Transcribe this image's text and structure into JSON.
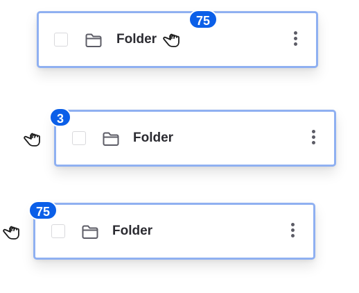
{
  "colors": {
    "accent": "#0b5fe8",
    "card_border": "#8fb0f1"
  },
  "cards": [
    {
      "label": "Folder",
      "badge": "75",
      "icons": [
        "folder-icon",
        "grab-hand-icon",
        "kebab-menu-icon"
      ]
    },
    {
      "label": "Folder",
      "badge": "3",
      "icons": [
        "folder-icon",
        "grab-hand-icon",
        "kebab-menu-icon"
      ]
    },
    {
      "label": "Folder",
      "badge": "75",
      "icons": [
        "folder-icon",
        "grab-hand-icon",
        "kebab-menu-icon"
      ]
    }
  ]
}
